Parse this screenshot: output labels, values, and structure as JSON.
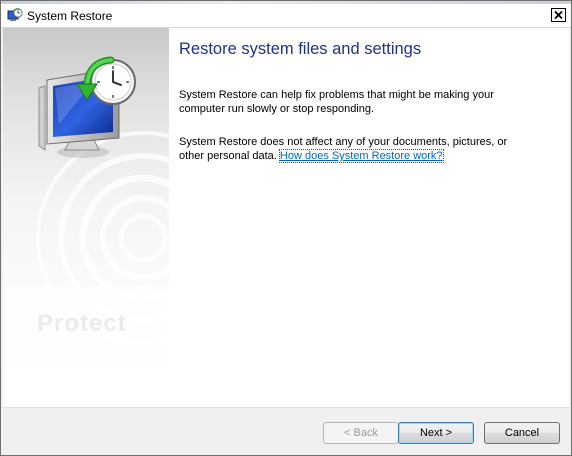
{
  "window": {
    "title": "System Restore",
    "icon": "system-restore-icon"
  },
  "main": {
    "heading": "Restore system files and settings",
    "paragraph1": "System Restore can help fix problems that might be making your computer run slowly or stop responding.",
    "paragraph2_text": "System Restore does not affect any of your documents, pictures, or other personal data.",
    "help_link": "How does System Restore work?"
  },
  "left_panel": {
    "watermark": "Protect"
  },
  "buttons": {
    "back": "< Back",
    "next": "Next >",
    "cancel": "Cancel"
  },
  "colors": {
    "heading": "#1e3287",
    "link": "#0066cc",
    "button_default_border": "#3c7fb1"
  }
}
